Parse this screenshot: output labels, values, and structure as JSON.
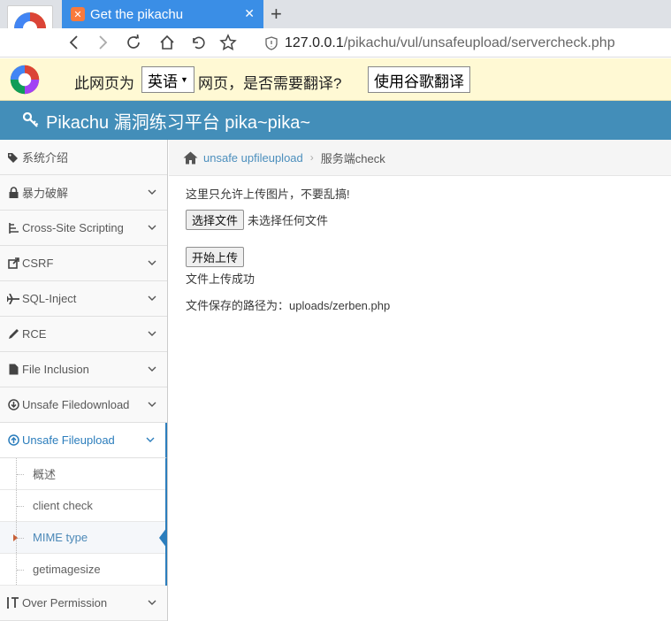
{
  "browser": {
    "tab_title": "Get the pikachu",
    "tab_close": "✕",
    "new_tab": "+",
    "url_host": "127.0.0.1",
    "url_path": "/pikachu/vul/unsafeupload/servercheck.php"
  },
  "translate_bar": {
    "prefix": "此网页为",
    "language": "英语",
    "suffix": "网页，是否需要翻译?",
    "button": "使用谷歌翻译"
  },
  "site": {
    "title": "Pikachu 漏洞练习平台 pika~pika~"
  },
  "sidebar": {
    "items": [
      {
        "label": "系统介绍",
        "icon": "tags-icon"
      },
      {
        "label": "暴力破解",
        "icon": "lock-icon"
      },
      {
        "label": "Cross-Site Scripting",
        "icon": "sitemap-icon"
      },
      {
        "label": "CSRF",
        "icon": "share-icon"
      },
      {
        "label": "SQL-Inject",
        "icon": "plane-icon"
      },
      {
        "label": "RCE",
        "icon": "pencil-icon"
      },
      {
        "label": "File Inclusion",
        "icon": "file-icon"
      },
      {
        "label": "Unsafe Filedownload",
        "icon": "download-circle-icon"
      },
      {
        "label": "Unsafe Fileupload",
        "icon": "upload-circle-icon"
      }
    ],
    "subitems": [
      {
        "label": "概述"
      },
      {
        "label": "client check"
      },
      {
        "label": "MIME type"
      },
      {
        "label": "getimagesize"
      }
    ],
    "last_item": {
      "label": "Over Permission",
      "icon": "text-height-icon"
    }
  },
  "breadcrumb": {
    "parent": "unsafe upfileupload",
    "separator": "›",
    "current": "服务端check"
  },
  "main": {
    "notice": "这里只允许上传图片，不要乱搞!",
    "choose_file": "选择文件",
    "no_file": "未选择任何文件",
    "upload_button": "开始上传",
    "success": "文件上传成功",
    "path": "文件保存的路径为：uploads/zerben.php"
  },
  "colors": {
    "header": "#438eb9",
    "tab": "#3a8ee6",
    "accent": "#2b7dbc",
    "translate_bg": "#fff9d4"
  }
}
